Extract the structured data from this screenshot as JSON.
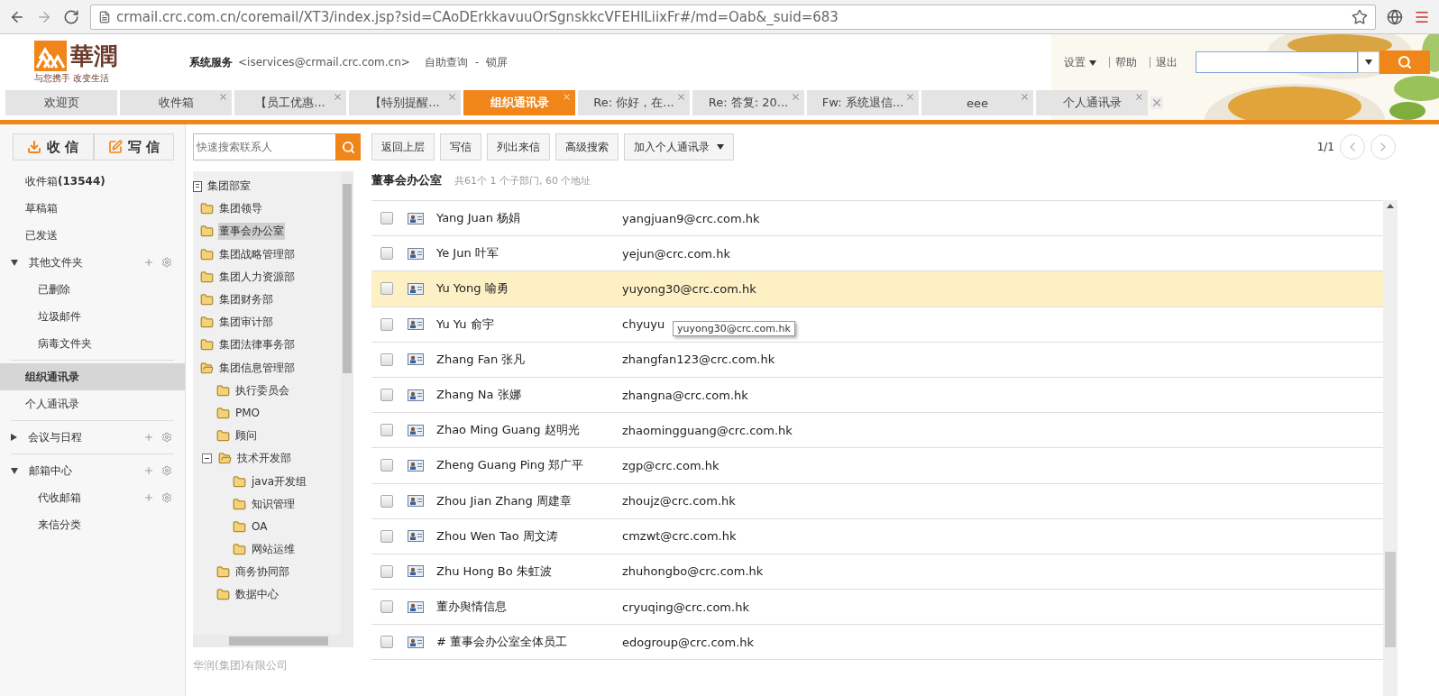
{
  "browser": {
    "url": "crmail.crc.com.cn/coremail/XT3/index.jsp?sid=CAoDErkkavuuOrSgnskkcVFEHlLiixFr#/md=Oab&_suid=683"
  },
  "header": {
    "logo_text": "華潤",
    "slogan": "与您携手 改变生活",
    "account_name": "系统服务",
    "account_email": "<iservices@crmail.crc.com.cn>",
    "links": [
      "自助查询",
      "-",
      "锁屏"
    ],
    "settings": "设置",
    "help": "帮助",
    "logout": "退出"
  },
  "tabs": [
    {
      "label": "欢迎页",
      "selected": false,
      "closable": false
    },
    {
      "label": "收件箱",
      "selected": false,
      "closable": true
    },
    {
      "label": "【员工优惠...",
      "selected": false,
      "closable": true
    },
    {
      "label": "【特别提醒...",
      "selected": false,
      "closable": true
    },
    {
      "label": "组织通讯录",
      "selected": true,
      "closable": true
    },
    {
      "label": "Re: 你好，在...",
      "selected": false,
      "closable": true
    },
    {
      "label": "Re: 答复: 20...",
      "selected": false,
      "closable": true
    },
    {
      "label": "Fw: 系统退信...",
      "selected": false,
      "closable": true
    },
    {
      "label": "eee",
      "selected": false,
      "closable": true
    },
    {
      "label": "个人通讯录",
      "selected": false,
      "closable": true
    }
  ],
  "sidebar": {
    "receive": "收 信",
    "compose": "写 信",
    "items": [
      {
        "kind": "item",
        "label": "收件箱**(13544)**",
        "selected": false
      },
      {
        "kind": "item",
        "label": "草稿箱",
        "selected": false
      },
      {
        "kind": "item",
        "label": "已发送",
        "selected": false
      },
      {
        "kind": "group",
        "label": "其他文件夹",
        "expanded": true,
        "children": [
          {
            "label": "已删除",
            "tools": false
          },
          {
            "label": "垃圾邮件",
            "tools": false
          },
          {
            "label": "病毒文件夹",
            "tools": false
          }
        ]
      },
      {
        "kind": "item",
        "label": "组织通讯录",
        "selected": true
      },
      {
        "kind": "item",
        "label": "个人通讯录",
        "selected": false
      },
      {
        "kind": "group",
        "label": "会议与日程",
        "expanded": false
      },
      {
        "kind": "group",
        "label": "邮箱中心",
        "expanded": true,
        "children": [
          {
            "label": "代收邮箱",
            "tools": true
          },
          {
            "label": "来信分类",
            "tools": false
          }
        ]
      }
    ]
  },
  "tree": {
    "search": {
      "placeholder": "快速搜索联系人"
    },
    "root": {
      "label": "集团部室",
      "children": [
        {
          "label": "集团领导",
          "selected": false
        },
        {
          "label": "董事会办公室",
          "selected": true
        },
        {
          "label": "集团战略管理部",
          "selected": false
        },
        {
          "label": "集团人力资源部",
          "selected": false
        },
        {
          "label": "集团财务部",
          "selected": false
        },
        {
          "label": "集团审计部",
          "selected": false
        },
        {
          "label": "集团法律事务部",
          "selected": false
        },
        {
          "label": "集团信息管理部",
          "selected": false,
          "expanded": true,
          "children": [
            {
              "label": "执行委员会",
              "selected": false
            },
            {
              "label": "PMO",
              "selected": false
            },
            {
              "label": "顾问",
              "selected": false
            },
            {
              "label": "技术开发部",
              "selected": false,
              "expanded": true,
              "toggle": true,
              "children": [
                {
                  "label": "java开发组",
                  "selected": false
                },
                {
                  "label": "知识管理",
                  "selected": false
                },
                {
                  "label": "OA",
                  "selected": false
                },
                {
                  "label": "网站运维",
                  "selected": false
                }
              ]
            },
            {
              "label": "商务协同部",
              "selected": false
            },
            {
              "label": "数据中心",
              "selected": false
            }
          ]
        }
      ]
    },
    "footer": "华润(集团)有限公司"
  },
  "toolbar": {
    "buttons": [
      {
        "label": "返回上层",
        "dropdown": false
      },
      {
        "label": "写信",
        "dropdown": false
      },
      {
        "label": "列出来信",
        "dropdown": false
      },
      {
        "label": "高级搜索",
        "dropdown": false
      },
      {
        "label": "加入个人通讯录",
        "dropdown": true
      }
    ],
    "page": "1/1"
  },
  "list": {
    "title": "董事会办公室",
    "summary": "共61个 1 个子部门, 60 个地址",
    "rows": [
      {
        "name": "Yang Juan 杨娟",
        "email": "yangjuan9@crc.com.hk",
        "selected": false,
        "checked": false
      },
      {
        "name": "Ye Jun 叶军",
        "email": "yejun@crc.com.hk",
        "selected": false,
        "checked": false
      },
      {
        "name": "Yu Yong 喻勇",
        "email": "yuyong30@crc.com.hk",
        "selected": true,
        "checked": false
      },
      {
        "name": "Yu Yu 俞宇",
        "email": "chyuyu",
        "selected": false,
        "checked": false,
        "tooltip": "yuyong30@crc.com.hk"
      },
      {
        "name": "Zhang Fan 张凡",
        "email": "zhangfan123@crc.com.hk",
        "selected": false,
        "checked": false
      },
      {
        "name": "Zhang Na 张娜",
        "email": "zhangna@crc.com.hk",
        "selected": false,
        "checked": false
      },
      {
        "name": "Zhao Ming Guang 赵明光",
        "email": "zhaomingguang@crc.com.hk",
        "selected": false,
        "checked": false
      },
      {
        "name": "Zheng Guang Ping 郑广平",
        "email": "zgp@crc.com.hk",
        "selected": false,
        "checked": false
      },
      {
        "name": "Zhou Jian Zhang 周建章",
        "email": "zhoujz@crc.com.hk",
        "selected": false,
        "checked": false
      },
      {
        "name": "Zhou Wen Tao 周文涛",
        "email": "cmzwt@crc.com.hk",
        "selected": false,
        "checked": false
      },
      {
        "name": "Zhu Hong Bo 朱虹波",
        "email": "zhuhongbo@crc.com.hk",
        "selected": false,
        "checked": false
      },
      {
        "name": "董办舆情信息",
        "email": "cryuqing@crc.com.hk",
        "selected": false,
        "checked": false
      },
      {
        "name": "# 董事会办公室全体员工",
        "email": "edogroup@crc.com.hk",
        "selected": false,
        "checked": false
      }
    ]
  }
}
